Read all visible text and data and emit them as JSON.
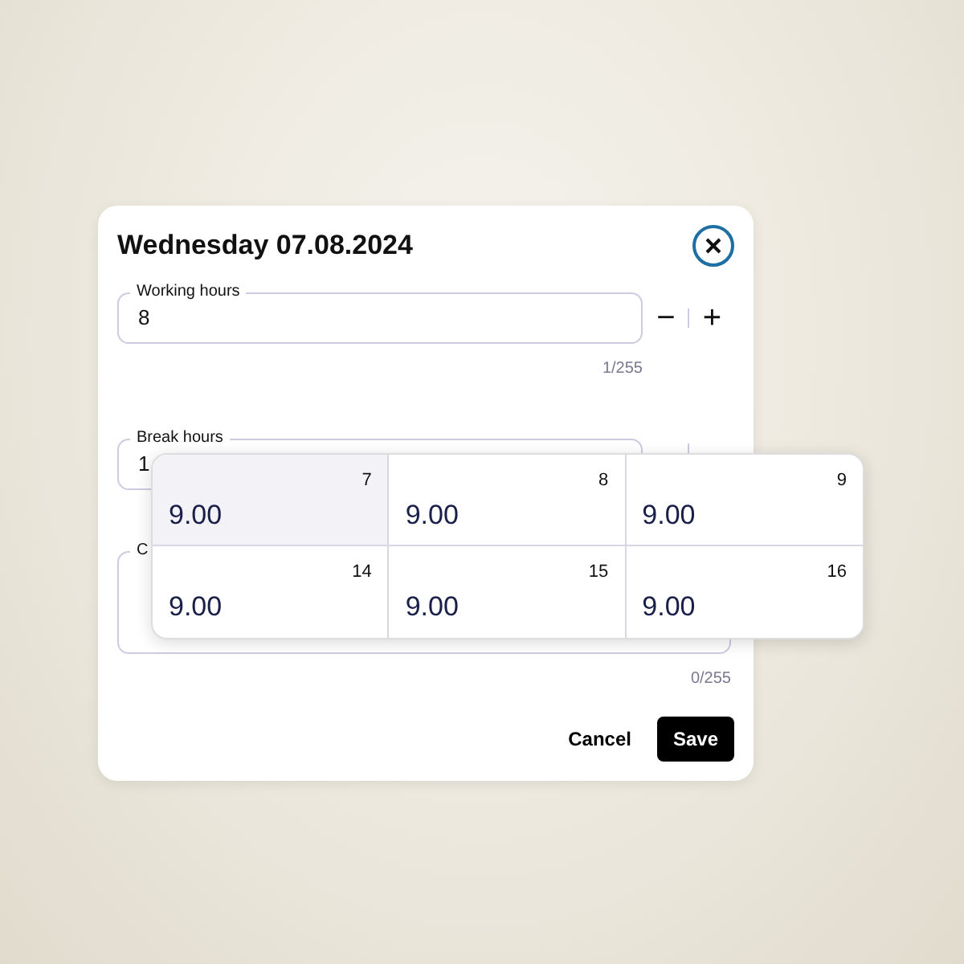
{
  "dialog": {
    "title": "Wednesday 07.08.2024"
  },
  "fields": [
    {
      "kind": "stepper",
      "label": "Working hours",
      "value": "8",
      "minus": "−",
      "plus": "+",
      "counter": "1/255"
    },
    {
      "kind": "stepper-partial",
      "label": "Break hours",
      "value": "1"
    },
    {
      "kind": "textarea",
      "label": "C",
      "counter": "0/255"
    }
  ],
  "buttons": {
    "cancel": "Cancel",
    "save": "Save"
  },
  "popup": {
    "cells": [
      {
        "day": "7",
        "value": "9.00",
        "selected": true
      },
      {
        "day": "8",
        "value": "9.00",
        "selected": false
      },
      {
        "day": "9",
        "value": "9.00",
        "selected": false
      },
      {
        "day": "14",
        "value": "9.00",
        "selected": false
      },
      {
        "day": "15",
        "value": "9.00",
        "selected": false
      },
      {
        "day": "16",
        "value": "9.00",
        "selected": false
      }
    ]
  }
}
